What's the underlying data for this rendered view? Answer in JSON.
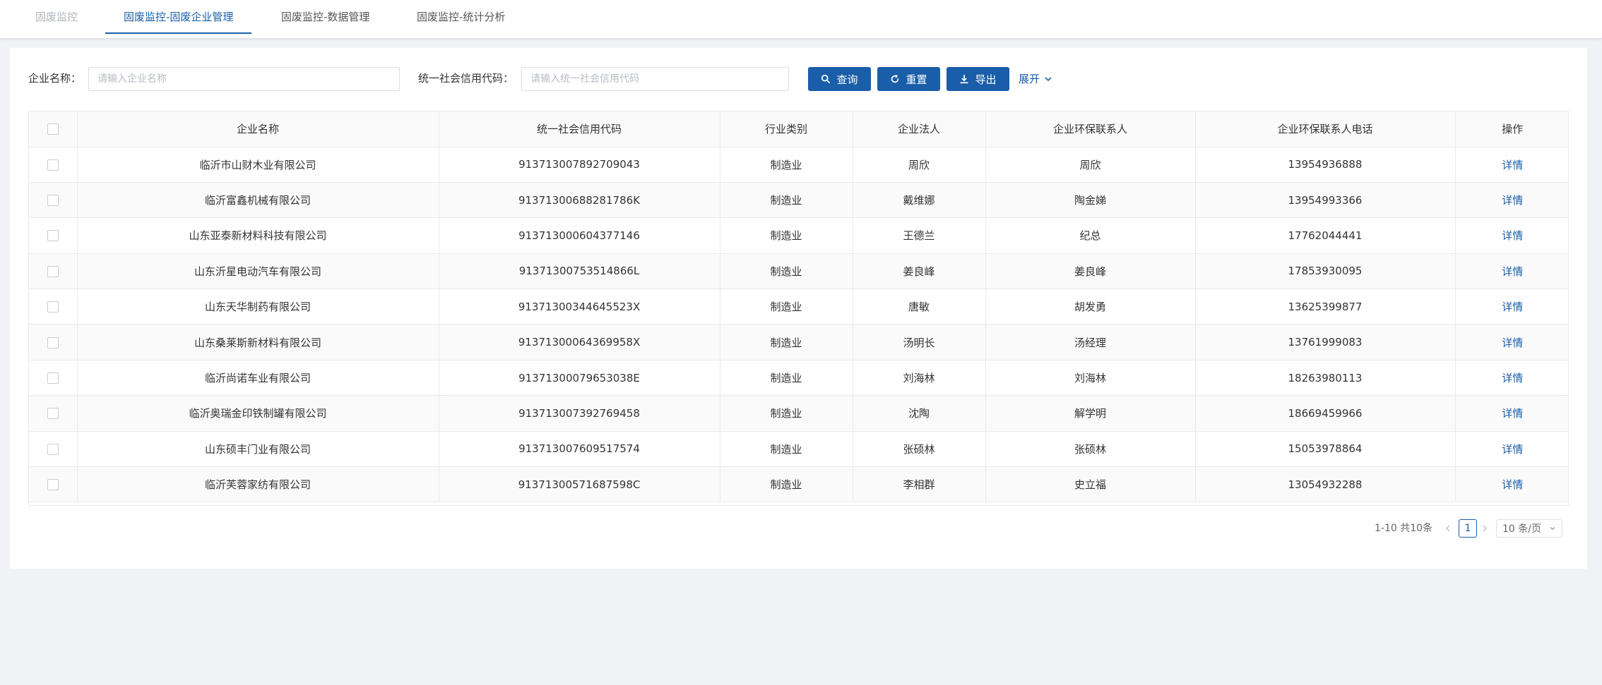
{
  "tabs": [
    {
      "label": "固废监控",
      "state": "disabled"
    },
    {
      "label": "固废监控-固废企业管理",
      "state": "active"
    },
    {
      "label": "固废监控-数据管理",
      "state": "normal"
    },
    {
      "label": "固废监控-统计分析",
      "state": "normal"
    }
  ],
  "filter": {
    "company_name_label": "企业名称：",
    "company_name_placeholder": "请输入企业名称",
    "company_name_value": "",
    "credit_code_label": "统一社会信用代码：",
    "credit_code_placeholder": "请输入统一社会信用代码",
    "credit_code_value": "",
    "query_label": "查询",
    "reset_label": "重置",
    "export_label": "导出",
    "expand_label": "展开"
  },
  "table": {
    "columns": [
      "",
      "企业名称",
      "统一社会信用代码",
      "行业类别",
      "企业法人",
      "企业环保联系人",
      "企业环保联系人电话",
      "操作"
    ],
    "rows": [
      {
        "name": "临沂市山财木业有限公司",
        "code": "913713007892709043",
        "industry": "制造业",
        "legal": "周欣",
        "contact": "周欣",
        "phone": "13954936888",
        "action": "详情"
      },
      {
        "name": "临沂富鑫机械有限公司",
        "code": "91371300688281786K",
        "industry": "制造业",
        "legal": "戴维娜",
        "contact": "陶金娣",
        "phone": "13954993366",
        "action": "详情"
      },
      {
        "name": "山东亚泰新材料科技有限公司",
        "code": "913713000604377146",
        "industry": "制造业",
        "legal": "王德兰",
        "contact": "纪总",
        "phone": "17762044441",
        "action": "详情"
      },
      {
        "name": "山东沂星电动汽车有限公司",
        "code": "91371300753514866L",
        "industry": "制造业",
        "legal": "姜良峰",
        "contact": "姜良峰",
        "phone": "17853930095",
        "action": "详情"
      },
      {
        "name": "山东天华制药有限公司",
        "code": "91371300344645523X",
        "industry": "制造业",
        "legal": "唐敏",
        "contact": "胡发勇",
        "phone": "13625399877",
        "action": "详情"
      },
      {
        "name": "山东桑莱斯新材料有限公司",
        "code": "91371300064369958X",
        "industry": "制造业",
        "legal": "汤明长",
        "contact": "汤经理",
        "phone": "13761999083",
        "action": "详情"
      },
      {
        "name": "临沂尚诺车业有限公司",
        "code": "91371300079653038E",
        "industry": "制造业",
        "legal": "刘海林",
        "contact": "刘海林",
        "phone": "18263980113",
        "action": "详情"
      },
      {
        "name": "临沂奥瑞金印铁制罐有限公司",
        "code": "913713007392769458",
        "industry": "制造业",
        "legal": "沈陶",
        "contact": "解学明",
        "phone": "18669459966",
        "action": "详情"
      },
      {
        "name": "山东硕丰门业有限公司",
        "code": "913713007609517574",
        "industry": "制造业",
        "legal": "张硕林",
        "contact": "张硕林",
        "phone": "15053978864",
        "action": "详情"
      },
      {
        "name": "临沂芙蓉家纺有限公司",
        "code": "91371300571687598C",
        "industry": "制造业",
        "legal": "李相群",
        "contact": "史立福",
        "phone": "13054932288",
        "action": "详情"
      }
    ]
  },
  "pagination": {
    "total_text": "1-10 共10条",
    "current_page": "1",
    "page_size": "10 条/页",
    "prev_icon": "chevron-left-icon",
    "next_icon": "chevron-right-icon"
  },
  "colors": {
    "primary": "#1a5da8",
    "background": "#f0f2f5"
  }
}
